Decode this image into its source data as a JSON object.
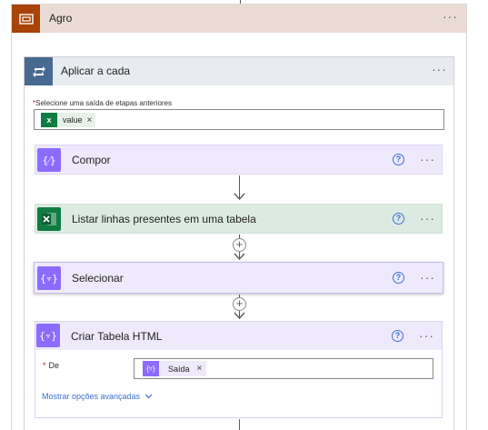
{
  "scope": {
    "title": "Agro",
    "color": "#a94307",
    "header_bg": "#eadcd4"
  },
  "loop": {
    "title": "Aplicar a cada",
    "header_bg": "#e8ecf1",
    "icon_bg": "#486991",
    "field_label": "Selecione uma saída de etapas anteriores",
    "token": "value"
  },
  "actions": [
    {
      "title": "Compor",
      "bg": "#eeeafb",
      "icon_bg": "#8c6cff"
    },
    {
      "title": "Listar linhas presentes em uma tabela",
      "bg": "#dcebe1",
      "icon_bg": "#107c41"
    },
    {
      "title": "Selecionar",
      "bg": "#eeeafb",
      "icon_bg": "#8c6cff"
    },
    {
      "title": "Criar Tabela HTML",
      "bg": "#eeeafb",
      "icon_bg": "#8c6cff"
    }
  ],
  "html_table": {
    "field_label": "De",
    "token": "Saída",
    "advanced_link": "Mostrar opções avançadas"
  },
  "icons": {
    "scope": "scope-icon",
    "loop": "loop-icon",
    "excel": "excel-icon",
    "compose": "compose-icon",
    "select": "select-icon",
    "more": "more-icon",
    "help": "help-icon",
    "plus": "add-step-icon"
  }
}
